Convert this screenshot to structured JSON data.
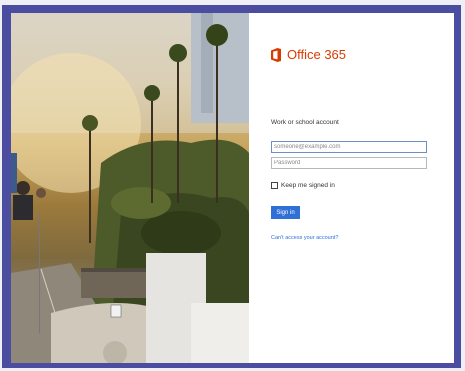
{
  "brand": {
    "name": "Office 365",
    "color": "#d83b01",
    "icon": "office-logo-icon"
  },
  "form": {
    "heading": "Work or school account",
    "email_placeholder": "someone@example.com",
    "password_placeholder": "Password",
    "keep_signed_in_label": "Keep me signed in",
    "sign_in_label": "Sign in",
    "cant_access_label": "Can't access your account?"
  },
  "colors": {
    "frame": "#4a4da0",
    "accent": "#2e70d6"
  }
}
